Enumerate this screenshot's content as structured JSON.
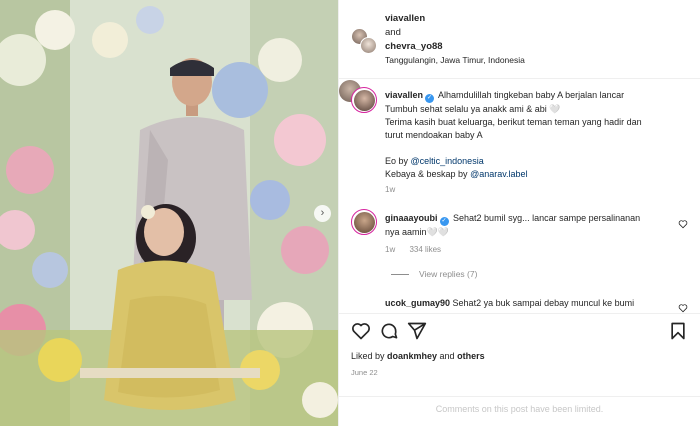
{
  "post": {
    "image_alt": "Couple posing among flowers at a maternity ceremony",
    "next_icon": "chevron-right-icon"
  },
  "header": {
    "user1": "viavallen",
    "and_text": "and",
    "user2": "chevra_yo88",
    "location": "Tanggulangin, Jawa Timur, Indonesia"
  },
  "caption": {
    "username": "viavallen",
    "line1": "Alhamdulillah tingkeban baby A berjalan lancar",
    "line2": "Tumbuh sehat selalu ya anakk ami & abi 🤍",
    "line3": "Terima kasih buat keluarga, berikut teman teman yang hadir dan",
    "line4": "turut mendoakan baby A",
    "eo_prefix": "Eo by ",
    "eo_link": "@celtic_indonesia",
    "kebaya_prefix": "Kebaya & beskap by ",
    "kebaya_link": "@anarav.label",
    "time": "1w"
  },
  "comments": [
    {
      "username": "ginaaayoubi",
      "text_line1": "Sehat2 bumil syg... lancar sampe persalinanan",
      "text_line2": "nya aamin🤍🤍",
      "time": "1w",
      "likes": "334 likes",
      "replies": "View replies (7)"
    },
    {
      "username": "ucok_gumay90",
      "text": "Sehat2 ya buk sampai debay muncul ke bumi"
    }
  ],
  "actions": {
    "liked_by_prefix": "Liked by ",
    "liked_by_user": "doankmhey",
    "liked_by_and": " and ",
    "liked_by_others": "others",
    "date": "June 22"
  },
  "footer": {
    "limited_text": "Comments on this post have been limited."
  },
  "colors": {
    "verified": "#3897f0",
    "link": "#00376b",
    "muted": "#8e8e8e",
    "ring": "#d6249f"
  }
}
